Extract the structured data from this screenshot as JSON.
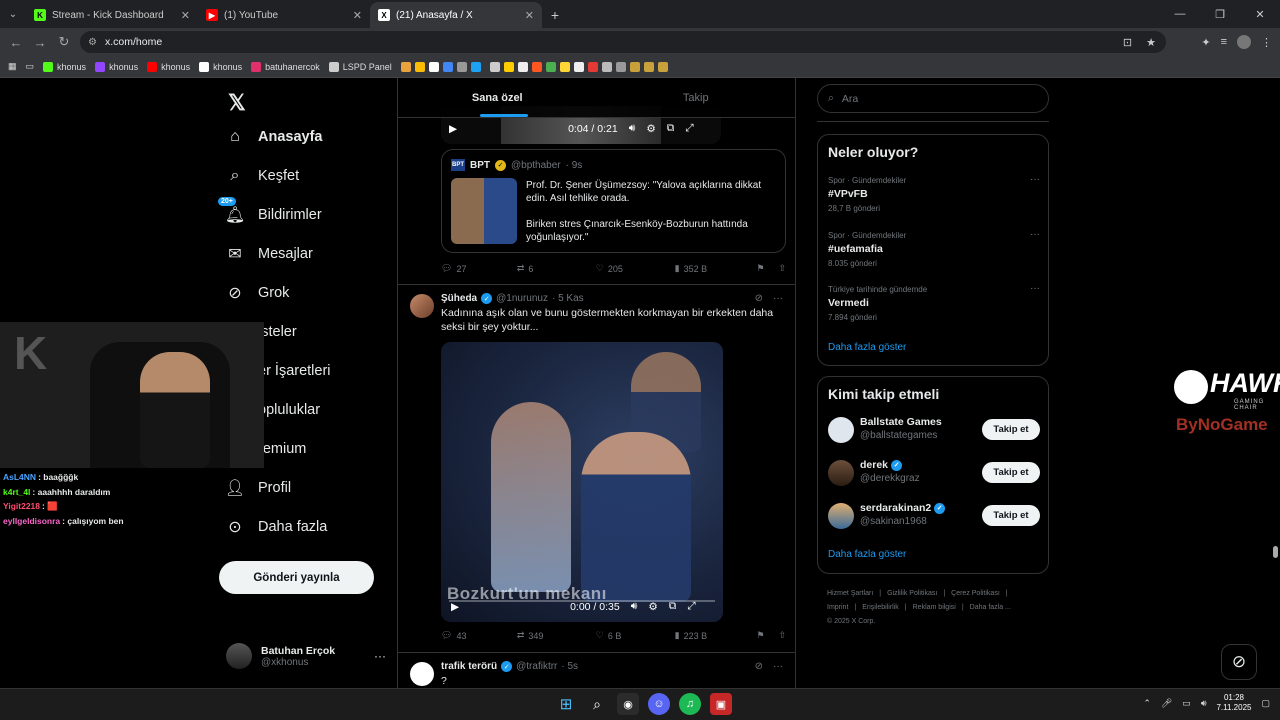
{
  "browser": {
    "tabs": [
      {
        "title": "Stream - Kick Dashboard",
        "icon": "kick-icon",
        "color": "#53fc18",
        "glyph": "K"
      },
      {
        "title": "(1) YouTube",
        "icon": "youtube-icon",
        "color": "#ff0000",
        "glyph": "▶"
      },
      {
        "title": "(21) Anasayfa / X",
        "icon": "x-icon",
        "color": "#000000",
        "glyph": "𝕏"
      }
    ],
    "url": "x.com/home",
    "bookmarks": [
      {
        "label": "khonus",
        "color": "#53fc18"
      },
      {
        "label": "khonus",
        "color": "#9146ff"
      },
      {
        "label": "khonus",
        "color": "#ff0000"
      },
      {
        "label": "khonus",
        "color": "#ffffff"
      },
      {
        "label": "batuhanercok",
        "color": "#e1306c"
      },
      {
        "label": "LSPD Panel",
        "color": "#cccccc"
      }
    ]
  },
  "nav": {
    "items": [
      {
        "label": "Anasayfa",
        "icon": "home-icon"
      },
      {
        "label": "Keşfet",
        "icon": "search-icon"
      },
      {
        "label": "Bildirimler",
        "icon": "bell-icon",
        "badge": "20+"
      },
      {
        "label": "Mesajlar",
        "icon": "mail-icon"
      },
      {
        "label": "Grok",
        "icon": "grok-icon"
      },
      {
        "label": "isteler",
        "icon": "list-icon"
      },
      {
        "label": "er İşaretleri",
        "icon": "bookmark-icon"
      },
      {
        "label": "opluluklar",
        "icon": "communities-icon"
      },
      {
        "label": "remium",
        "icon": "premium-icon"
      },
      {
        "label": "Profil",
        "icon": "profile-icon"
      },
      {
        "label": "Daha fazla",
        "icon": "more-icon"
      }
    ],
    "post_button": "Gönderi yayınla",
    "account": {
      "name": "Batuhan Erçok",
      "handle": "@xkhonus"
    }
  },
  "timeline": {
    "tabs": [
      "Sana özel",
      "Takip"
    ],
    "top_video": {
      "time": "0:04 / 0:21"
    },
    "quote": {
      "name": "BPT",
      "handle": "@bpthaber",
      "time": "· 9s",
      "text1": "Prof. Dr. Şener Üşümezsoy: \"Yalova açıklarına dikkat edin. Asıl tehlike orada.",
      "text2": "Biriken stres Çınarcık-Esenköy-Bozburun hattında yoğunlaşıyor.\""
    },
    "post1_actions": {
      "replies": "27",
      "reposts": "6",
      "likes": "205",
      "views": "352 B"
    },
    "post2": {
      "name": "Şüheda",
      "handle": "@1nurunuz",
      "time": "· 5 Kas",
      "text": "Kadınına aşık olan ve bunu göstermekten korkmayan bir erkekten daha seksi bir şey yoktur...",
      "video_caption": "Bozkurt'un mekanı",
      "video_time": "0:00 / 0:35",
      "actions": {
        "replies": "43",
        "reposts": "349",
        "likes": "6 B",
        "views": "223 B"
      }
    },
    "post3": {
      "name": "trafik terörü",
      "handle": "@trafiktrr",
      "time": "· 5s",
      "text": "?"
    }
  },
  "right": {
    "search_placeholder": "Ara",
    "trends_title": "Neler oluyor?",
    "trends": [
      {
        "meta": "Spor · Gündemdekiler",
        "name": "#VPvFB",
        "count": "28,7 B gönderi"
      },
      {
        "meta": "Spor · Gündemdekiler",
        "name": "#uefamafia",
        "count": "8.035 gönderi"
      },
      {
        "meta": "Türkiye tarihinde gündemde",
        "name": "Vermedi",
        "count": "7.894 gönderi"
      }
    ],
    "show_more": "Daha fazla göster",
    "who_title": "Kimi takip etmeli",
    "who": [
      {
        "name": "Ballstate Games",
        "handle": "@ballstategames",
        "button": "Takip et",
        "verified": false
      },
      {
        "name": "derek",
        "handle": "@derekkgraz",
        "button": "Takip et",
        "verified": true
      },
      {
        "name": "serdarakinan2",
        "handle": "@sakinan1968",
        "button": "Takip et",
        "verified": true
      }
    ],
    "footer": [
      "Hizmet Şartları",
      "|",
      "Gizlilik Politikası",
      "|",
      "Çerez Politikası",
      "|",
      "Imprint",
      "|",
      "Erişilebilirlik",
      "|",
      "Reklam bilgisi",
      "|",
      "Daha fazla ...",
      "© 2025 X Corp."
    ]
  },
  "chat": [
    {
      "user": "AsL4NN",
      "color": "#4aa3ff",
      "msg": ": baağğğk"
    },
    {
      "user": "k4rt_4l",
      "color": "#53fc18",
      "msg": ": aaahhhh daraldım"
    },
    {
      "user": "Yigit2218",
      "color": "#ff4d6d",
      "msg": ": 🟥"
    },
    {
      "user": "eyllgeldisonra",
      "color": "#ff66cc",
      "msg": ": çalışıyom ben"
    }
  ],
  "brand": {
    "name": "HAWK",
    "sub": "GAMING CHAIR",
    "by": "ByNoGame"
  },
  "taskbar": {
    "time": "01:28",
    "date": "7.11.2025"
  }
}
